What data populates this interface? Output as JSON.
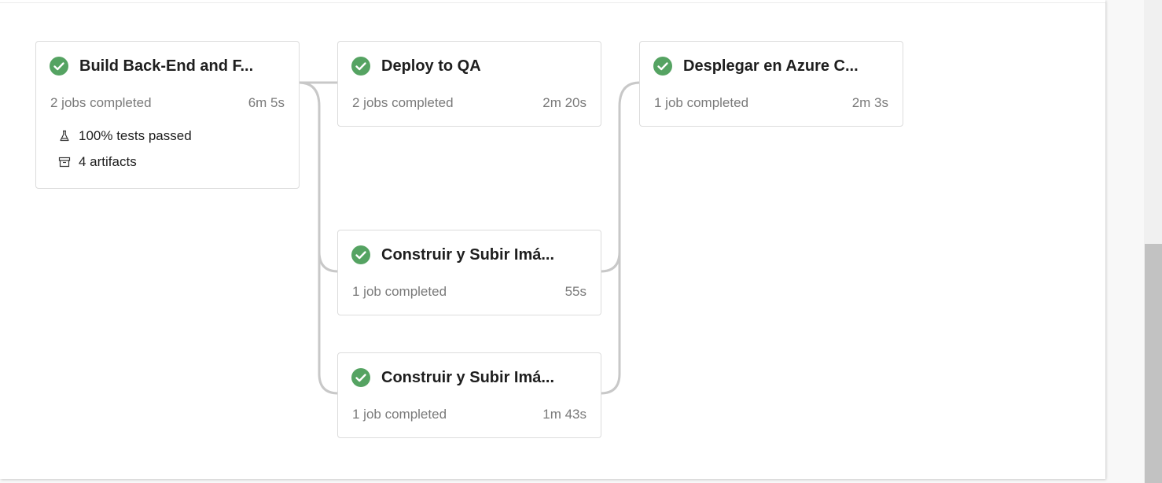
{
  "colors": {
    "success": "#55a362",
    "connector": "#c8c8c8"
  },
  "stages": [
    {
      "title": "Build Back-End and F...",
      "jobs": "2 jobs completed",
      "duration": "6m 5s",
      "tests": "100% tests passed",
      "artifacts": "4 artifacts",
      "status_icon": "check-circle-icon"
    },
    {
      "title": "Deploy to QA",
      "jobs": "2 jobs completed",
      "duration": "2m 20s",
      "status_icon": "check-circle-icon"
    },
    {
      "title": "Desplegar en Azure C...",
      "jobs": "1 job completed",
      "duration": "2m 3s",
      "status_icon": "check-circle-icon"
    },
    {
      "title": "Construir y Subir Imá...",
      "jobs": "1 job completed",
      "duration": "55s",
      "status_icon": "check-circle-icon"
    },
    {
      "title": "Construir y Subir Imá...",
      "jobs": "1 job completed",
      "duration": "1m 43s",
      "status_icon": "check-circle-icon"
    }
  ]
}
